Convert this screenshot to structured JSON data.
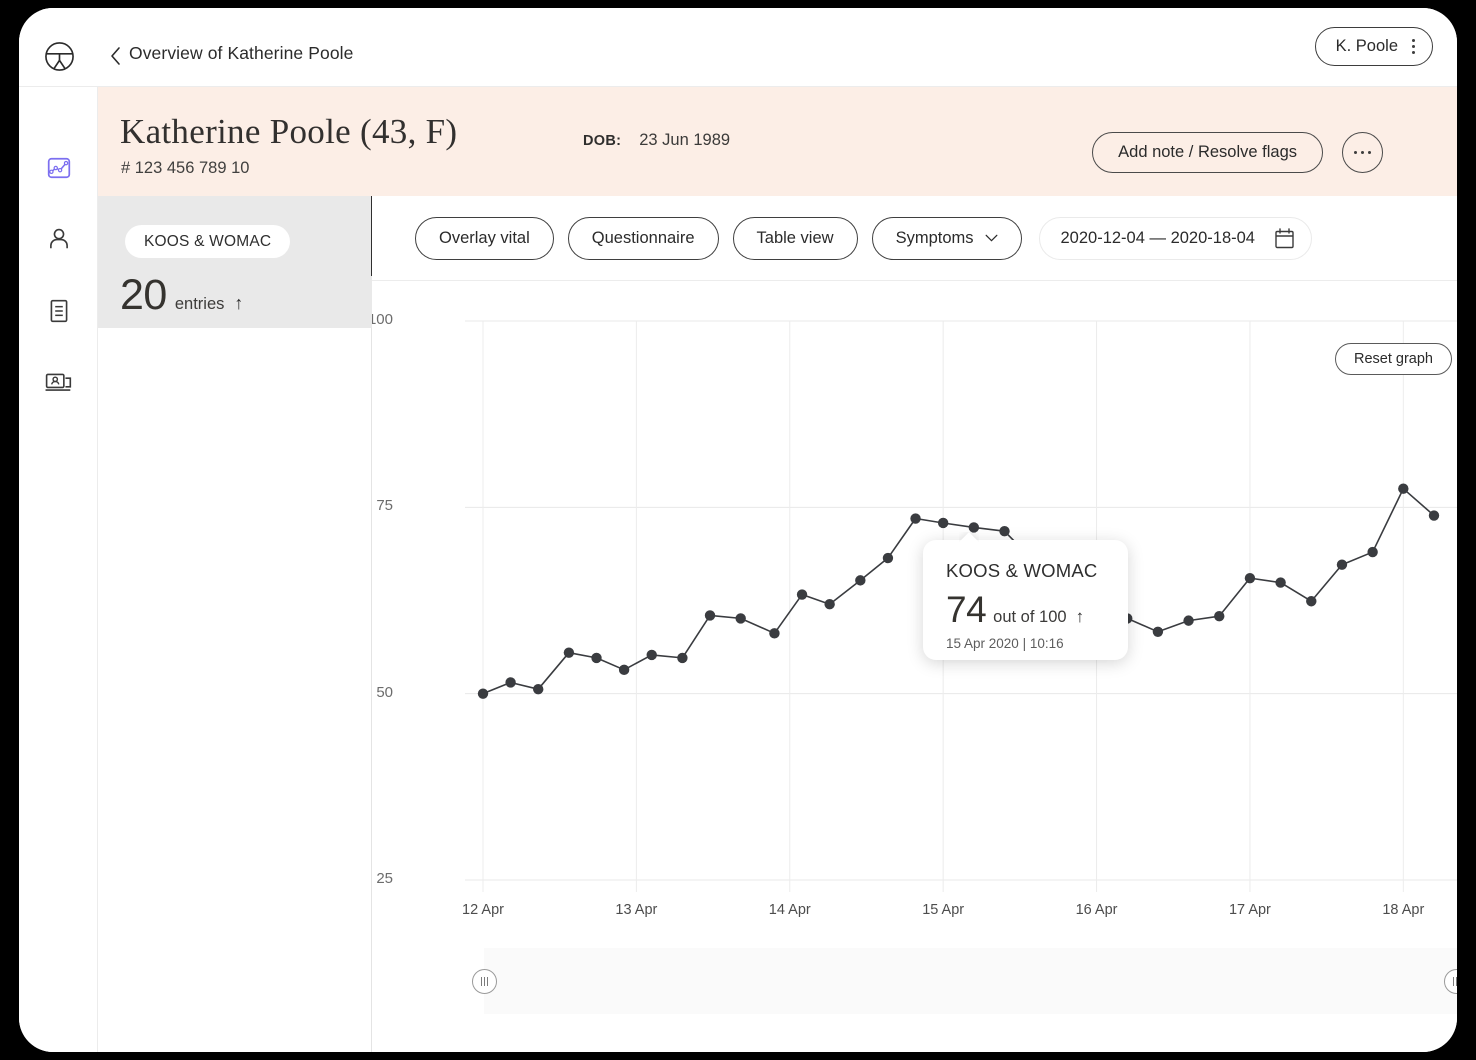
{
  "topbar": {
    "logo_icon": "app-logo-icon",
    "back_icon": "back-chevron-icon",
    "breadcrumb_title": "Overview of Katherine Poole",
    "user_name": "K. Poole",
    "user_menu_icon": "kebab-menu-icon"
  },
  "sidebar": {
    "items": [
      {
        "name": "charts",
        "icon": "chart-line-icon",
        "active": true,
        "color": "#7c6ff0"
      },
      {
        "name": "patient",
        "icon": "person-icon",
        "active": false
      },
      {
        "name": "records",
        "icon": "document-icon",
        "active": false
      },
      {
        "name": "video-consult",
        "icon": "video-consult-icon",
        "active": false
      }
    ]
  },
  "patient": {
    "name": "Katherine Poole (43, F)",
    "id": "# 123 456 789 10",
    "dob_label": "DOB:",
    "dob_value": "23 Jun 1989",
    "add_note_label": "Add note / Resolve flags",
    "more_icon": "more-dots-icon",
    "banner_color": "#fceee6"
  },
  "summary": {
    "chip_label": "KOOS & WOMAC",
    "entries_count": "20",
    "entries_label": "entries",
    "trend_arrow": "↑"
  },
  "toolbar": {
    "overlay_vital": "Overlay vital",
    "questionnaire": "Questionnaire",
    "table_view": "Table view",
    "symptoms": "Symptoms",
    "symptoms_chevron_icon": "chevron-down-icon",
    "date_range": "2020-12-04 — 2020-18-04",
    "calendar_icon": "calendar-icon"
  },
  "chart_controls": {
    "reset_label": "Reset graph",
    "brush_handle_icon": "drag-handle-icon"
  },
  "tooltip": {
    "title": "KOOS & WOMAC",
    "value": "74",
    "out_of": "out of 100",
    "trend_arrow": "↑",
    "timestamp": "15 Apr 2020 | 10:16"
  },
  "chart_data": {
    "type": "line",
    "title": "KOOS & WOMAC",
    "xlabel": "",
    "ylabel": "",
    "ylim": [
      25,
      100
    ],
    "yticks": [
      25,
      50,
      75,
      100
    ],
    "ytick_labels": [
      "25",
      "50",
      "75",
      "100"
    ],
    "xtick_labels": [
      "12 Apr",
      "13 Apr",
      "14 Apr",
      "15 Apr",
      "16 Apr",
      "17 Apr",
      "18 Apr"
    ],
    "grid": true,
    "legend": false,
    "marker_color": "#3a3c40",
    "line_color": "#3a3c40",
    "series": [
      {
        "name": "KOOS & WOMAC",
        "x": [
          12.0,
          12.18,
          12.36,
          12.56,
          12.74,
          12.92,
          13.1,
          13.3,
          13.48,
          13.68,
          13.9,
          14.08,
          14.26,
          14.46,
          14.64,
          14.82,
          15.0,
          15.2,
          15.4,
          15.6,
          15.8,
          16.0,
          16.2,
          16.4,
          16.6,
          16.8,
          17.0,
          17.2,
          17.4,
          17.6,
          17.8,
          18.0,
          18.2
        ],
        "values": [
          50,
          51.5,
          50.6,
          55.5,
          54.8,
          53.2,
          55.2,
          54.8,
          60.5,
          60.1,
          58.1,
          63.3,
          62.0,
          65.2,
          68.2,
          73.5,
          72.9,
          72.3,
          71.8,
          67.6,
          64.5,
          62.8,
          60.1,
          58.3,
          59.8,
          60.4,
          65.5,
          64.9,
          62.4,
          67.3,
          69.0,
          77.5,
          73.9
        ]
      }
    ],
    "highlighted_point": {
      "x": 15.0,
      "value": 74,
      "label": "15 Apr 2020 | 10:16"
    }
  }
}
